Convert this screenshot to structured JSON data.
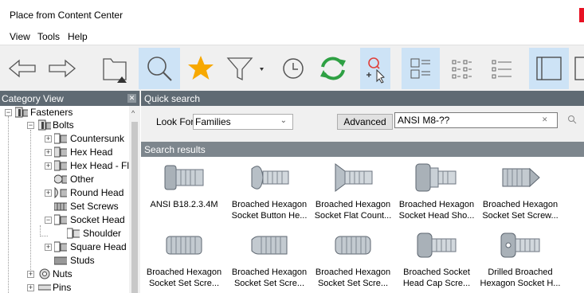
{
  "window": {
    "title": "Place from Content Center",
    "accent_color": "#e81123"
  },
  "menu": [
    "View",
    "Tools",
    "Help"
  ],
  "toolbar": {
    "buttons": [
      "back-icon",
      "forward-icon",
      "folder-up-icon",
      "search-icon",
      "favorite-star-icon",
      "filter-icon",
      "history-icon",
      "refresh-icon",
      "find-in-place-icon",
      "list-view-icon",
      "small-icons-view-icon",
      "details-view-icon",
      "single-pane-icon",
      "two-pane-icon"
    ]
  },
  "category_view": {
    "title": "Category View",
    "tree": [
      {
        "label": "Fasteners",
        "icon": "fasteners-icon"
      },
      {
        "label": "Bolts",
        "icon": "bolts-icon"
      },
      {
        "label": "Countersunk",
        "icon": "bolt-category-icon"
      },
      {
        "label": "Hex Head",
        "icon": "bolt-category-icon"
      },
      {
        "label": "Hex Head - Flar",
        "icon": "bolt-category-icon"
      },
      {
        "label": "Other",
        "icon": "bolt-category-icon"
      },
      {
        "label": "Round Head",
        "icon": "bolt-category-icon"
      },
      {
        "label": "Set Screws",
        "icon": "bolt-category-icon"
      },
      {
        "label": "Socket Head",
        "icon": "bolt-category-icon"
      },
      {
        "label": "Shoulder",
        "icon": "bolt-category-icon"
      },
      {
        "label": "Square Head",
        "icon": "bolt-category-icon"
      },
      {
        "label": "Studs",
        "icon": "bolt-category-icon"
      },
      {
        "label": "Nuts",
        "icon": "nuts-icon"
      },
      {
        "label": "Pins",
        "icon": "pins-icon"
      }
    ]
  },
  "quick_search": {
    "title": "Quick search",
    "look_for_label": "Look For:",
    "look_for_value": "Families",
    "advanced_label": "Advanced",
    "query": "ANSI M8-??",
    "accent_color": "#cde3f6"
  },
  "search_results": {
    "title": "Search results",
    "items": [
      {
        "line1": "ANSI B18.2.3.4M",
        "line2": ""
      },
      {
        "line1": "Broached Hexagon",
        "line2": "Socket Button He..."
      },
      {
        "line1": "Broached Hexagon",
        "line2": "Socket Flat Count..."
      },
      {
        "line1": "Broached Hexagon",
        "line2": "Socket Head Sho..."
      },
      {
        "line1": "Broached Hexagon",
        "line2": "Socket Set Screw..."
      },
      {
        "line1": "Broached Hexagon",
        "line2": "Socket Set Scre..."
      },
      {
        "line1": "Broached Hexagon",
        "line2": "Socket Set Scre..."
      },
      {
        "line1": "Broached Hexagon",
        "line2": "Socket Set Scre..."
      },
      {
        "line1": "Broached Socket",
        "line2": "Head Cap Scre..."
      },
      {
        "line1": "Drilled Broached",
        "line2": "Hexagon Socket H..."
      }
    ]
  }
}
